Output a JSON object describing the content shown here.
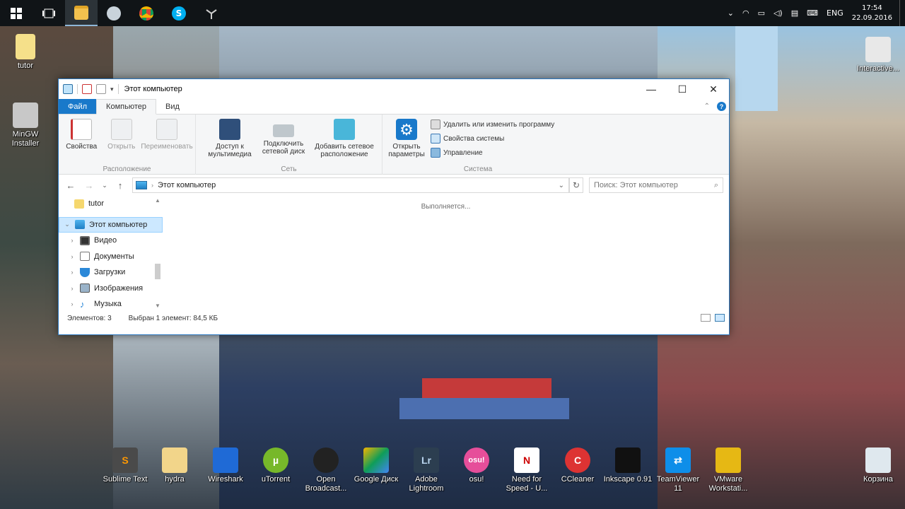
{
  "window": {
    "title": "Этот компьютер",
    "controls": {
      "minimize": "—",
      "maximize": "☐",
      "close": "✕"
    }
  },
  "ribbon": {
    "tabs": [
      "Файл",
      "Компьютер",
      "Вид"
    ],
    "groups": {
      "location": {
        "label": "Расположение",
        "buttons": [
          "Свойства",
          "Открыть",
          "Переименовать"
        ]
      },
      "network": {
        "label": "Сеть",
        "buttons": [
          "Доступ к мультимедиа",
          "Подключить сетевой диск",
          "Добавить сетевое расположение"
        ]
      },
      "system": {
        "label": "Система",
        "open_settings": "Открыть параметры",
        "small": [
          "Удалить или изменить программу",
          "Свойства системы",
          "Управление"
        ]
      }
    }
  },
  "address": {
    "path": "Этот компьютер",
    "search_placeholder": "Поиск: Этот компьютер"
  },
  "navpane": {
    "items": [
      "tutor",
      "Этот компьютер",
      "Видео",
      "Документы",
      "Загрузки",
      "Изображения",
      "Музыка"
    ]
  },
  "content": {
    "loading": "Выполняется..."
  },
  "status": {
    "count": "Элементов: 3",
    "selected": "Выбран 1 элемент: 84,5 КБ"
  },
  "taskbar": {
    "lang": "ENG",
    "time": "17:54",
    "date": "22.09.2016"
  },
  "desktop": {
    "icons": [
      "tutor",
      "MinGW Installer",
      "Interactive...",
      "Sublime Text",
      "hydra",
      "Wireshark",
      "uTorrent",
      "Open Broadcast...",
      "Google Диск",
      "Adobe Lightroom",
      "osu!",
      "Need for Speed - U...",
      "CCleaner",
      "Inkscape 0.91",
      "TeamViewer 11",
      "VMware Workstati...",
      "Корзина"
    ]
  },
  "colors": {
    "accent": "#1979ca",
    "selection": "#cce8ff",
    "taskbar": "#101417"
  }
}
